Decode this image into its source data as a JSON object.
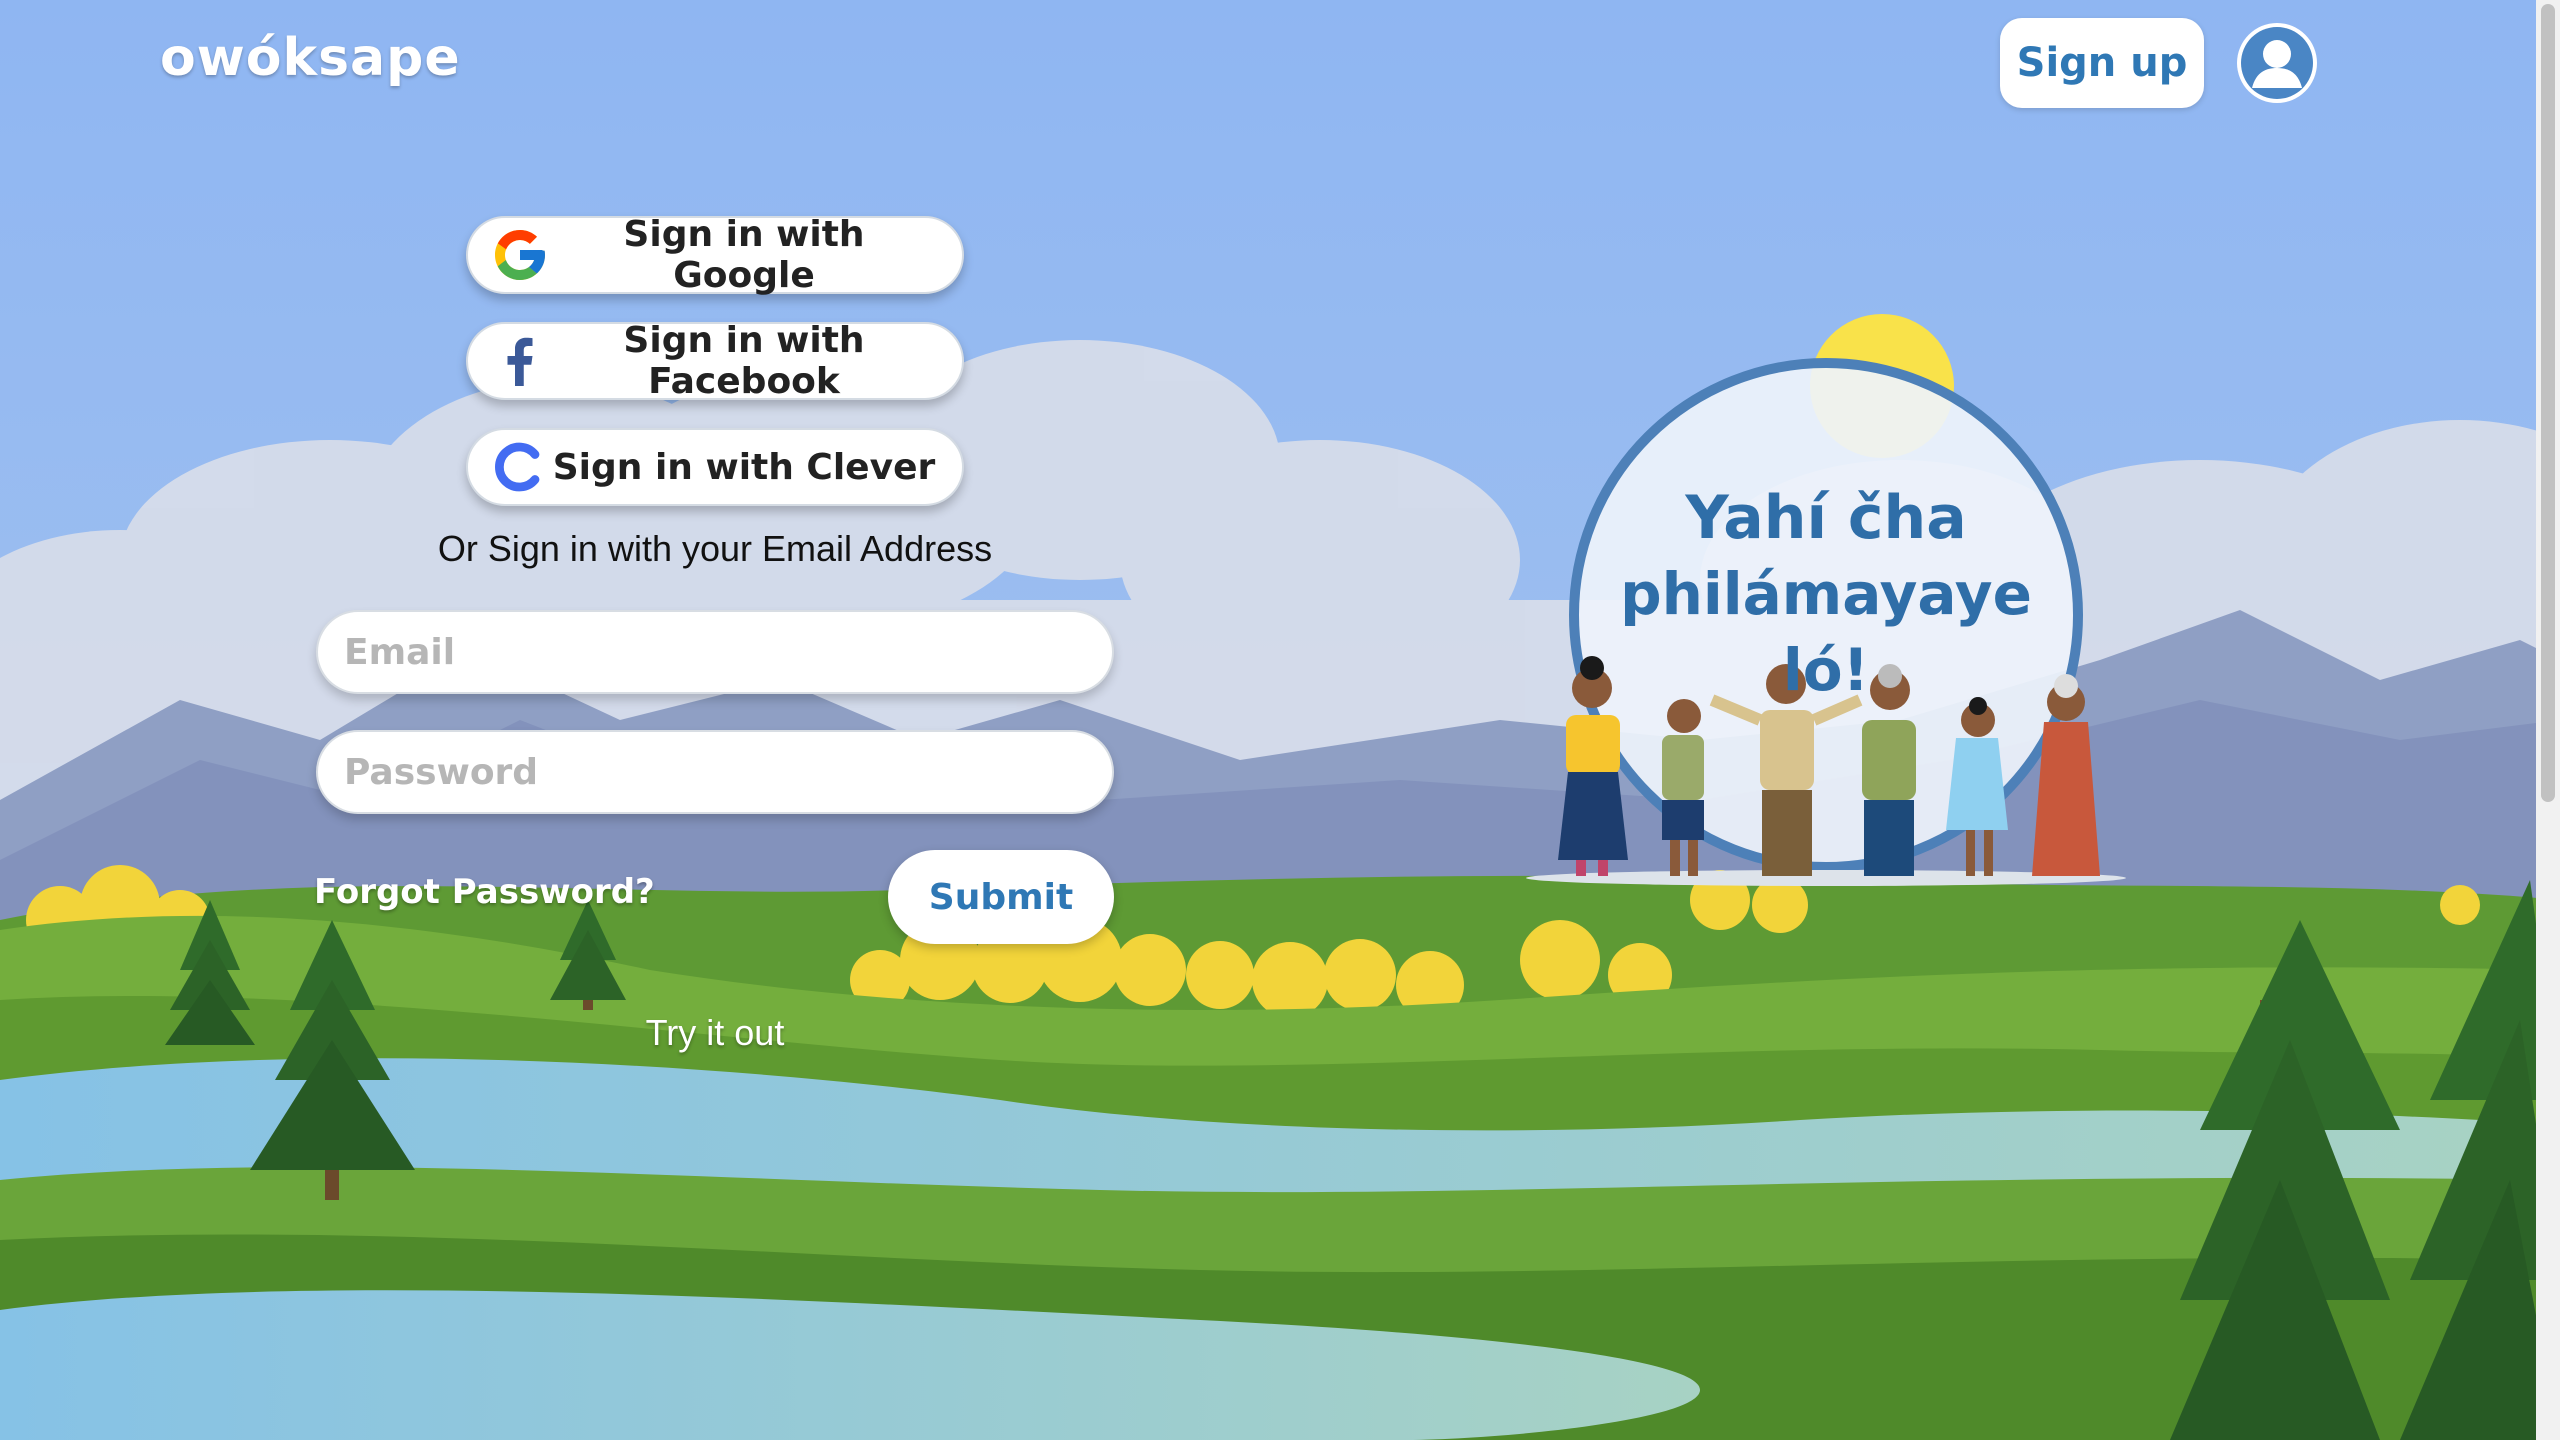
{
  "header": {
    "brand": "owóksape",
    "signup_label": "Sign up",
    "avatar_icon": "user-avatar-icon"
  },
  "login": {
    "google_label": "Sign in with Google",
    "facebook_label": "Sign in with Facebook",
    "clever_label": "Sign in with Clever",
    "or_text": "Or Sign in with your Email Address",
    "email_placeholder": "Email",
    "email_value": "",
    "password_placeholder": "Password",
    "password_value": "",
    "forgot_label": "Forgot Password?",
    "submit_label": "Submit",
    "try_label": "Try it out"
  },
  "hero": {
    "line1": "Yahí čha",
    "line2": "philámayaye ló!"
  },
  "colors": {
    "sky": "#93b8f0",
    "accent": "#2f78b5",
    "grass": "#6aa53a",
    "water": "#8ec7e3",
    "sun": "#f9e24a"
  }
}
